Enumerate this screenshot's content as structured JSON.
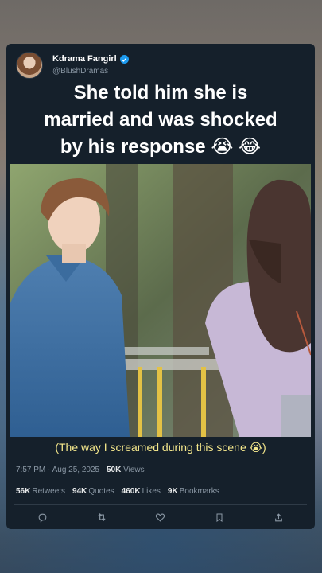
{
  "post": {
    "author_name": "Kdrama Fangirl",
    "author_handle": "@BlushDramas",
    "headline_lines": [
      "She told him she is",
      "married and was shocked",
      "by his response 😭 😂"
    ],
    "caption": "(The way I screamed during this scene 😭)",
    "time": "7:57 PM",
    "date": "Aug 25, 2025",
    "views_count": "50K",
    "views_label": "Views",
    "stats": {
      "retweets_count": "56K",
      "retweets_label": "Retweets",
      "quotes_count": "94K",
      "quotes_label": "Quotes",
      "likes_count": "460K",
      "likes_label": "Likes",
      "bookmarks_count": "9K",
      "bookmarks_label": "Bookmarks"
    }
  },
  "colors": {
    "card_bg": "#15202b",
    "verified": "#1d9bf0",
    "caption": "#f5e88c",
    "muted_text": "#8b98a5"
  },
  "icons": [
    "reply-icon",
    "retweet-icon",
    "like-icon",
    "bookmark-icon",
    "share-icon"
  ]
}
